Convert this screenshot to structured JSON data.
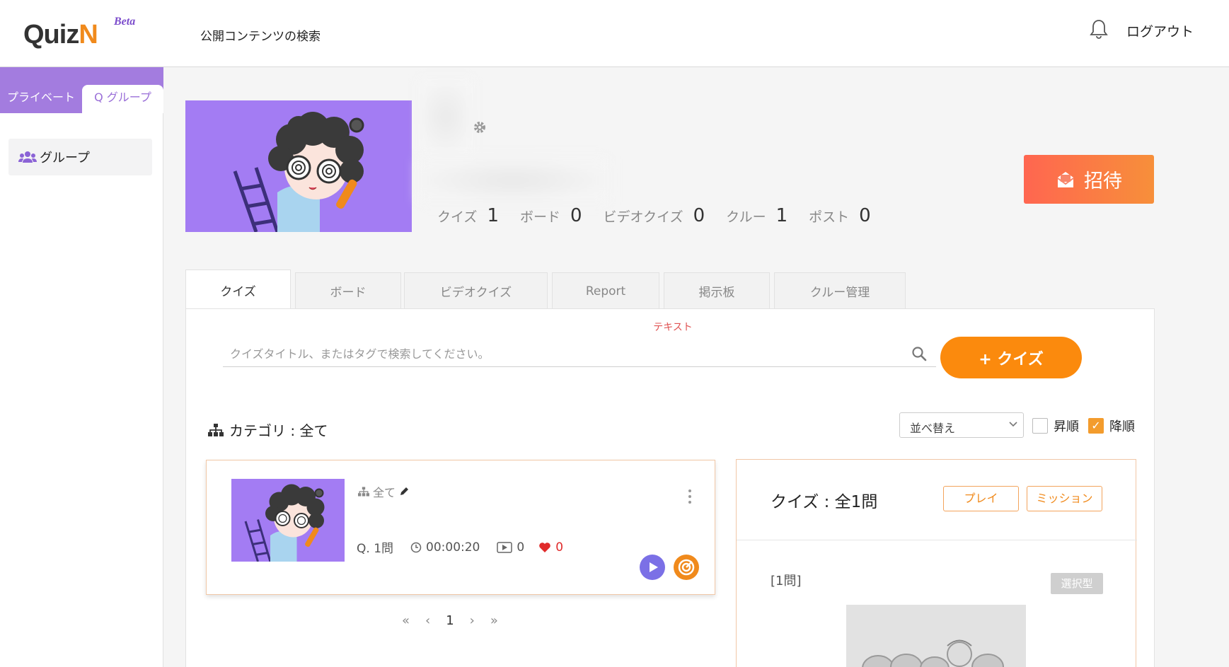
{
  "header": {
    "logo_main": "Quiz",
    "logo_n": "N",
    "logo_beta": "Beta",
    "nav_search": "公開コンテンツの検索",
    "logout": "ログアウト"
  },
  "sidebar": {
    "tabs": [
      {
        "label": "プライベート"
      },
      {
        "label": "Q グループ"
      }
    ],
    "items": [
      {
        "label": "グループ"
      }
    ]
  },
  "profile": {
    "stats": [
      {
        "label": "クイズ",
        "value": "1"
      },
      {
        "label": "ボード",
        "value": "0"
      },
      {
        "label": "ビデオクイズ",
        "value": "0"
      },
      {
        "label": "クルー",
        "value": "1"
      },
      {
        "label": "ポスト",
        "value": "0"
      }
    ],
    "invite_label": "招待"
  },
  "tabs": [
    {
      "label": "クイズ",
      "active": true
    },
    {
      "label": "ボード"
    },
    {
      "label": "ビデオクイズ"
    },
    {
      "label": "Report"
    },
    {
      "label": "掲示板"
    },
    {
      "label": "クルー管理"
    }
  ],
  "quiz_panel": {
    "hint": "テキスト",
    "search_placeholder": "クイズタイトル、またはタグで検索してください。",
    "add_quiz": "+ クイズ",
    "category": "カテゴリ : 全て",
    "sort_label": "並べ替え",
    "asc_label": "昇順",
    "desc_label": "降順",
    "desc_checked": true
  },
  "quiz_card": {
    "category": "全て",
    "questions": "Q. 1問",
    "time": "00:00:20",
    "plays": "0",
    "likes": "0"
  },
  "pagination": {
    "first": "«",
    "prev": "‹",
    "current": "1",
    "next": "›",
    "last": "»"
  },
  "right_panel": {
    "title": "クイズ : 全1問",
    "play_label": "プレイ",
    "mission_label": "ミッション",
    "question_no": "[1問]",
    "question_type": "選択型"
  },
  "colors": {
    "purple": "#a37cdf",
    "orange": "#fb8a0d",
    "invite_start": "#ff6650",
    "invite_end": "#f78f3a",
    "like_red": "#e02b2b"
  }
}
